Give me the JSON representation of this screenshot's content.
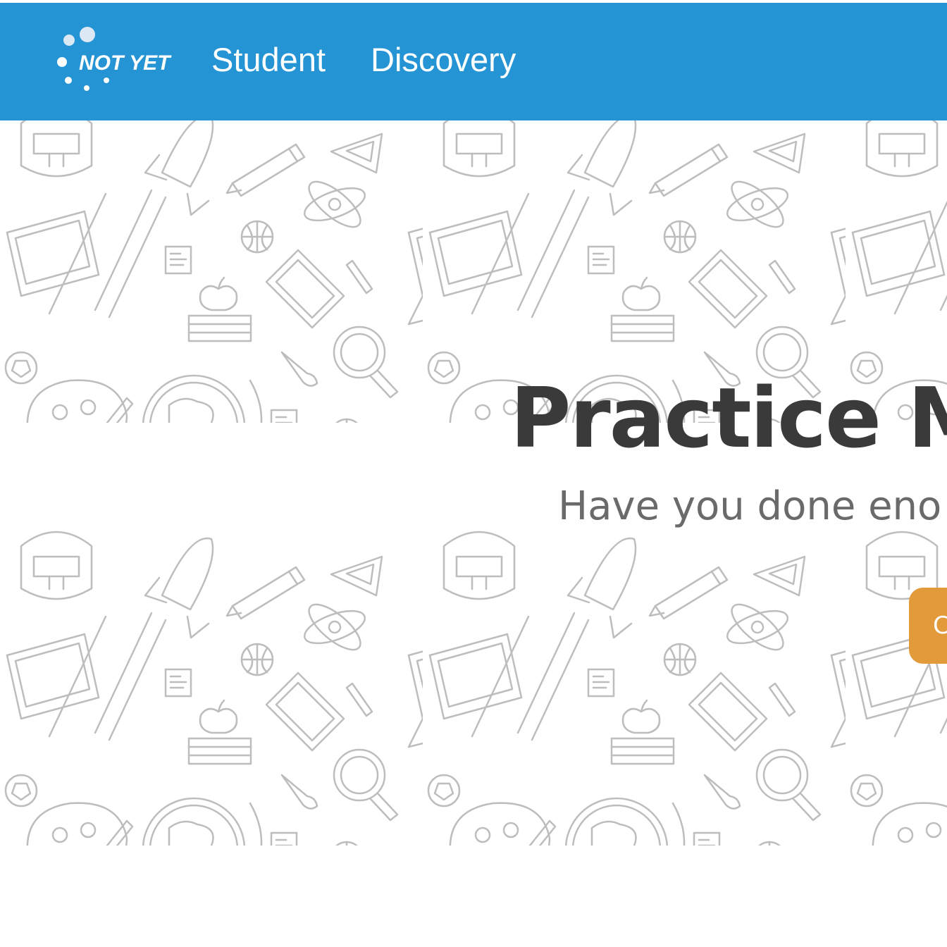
{
  "header": {
    "logo_text": "NOT YET",
    "nav": [
      {
        "label": "Student"
      },
      {
        "label": "Discovery"
      }
    ]
  },
  "hero": {
    "title": "Practice M",
    "subtitle": "Have you done eno",
    "cta_label": "C"
  },
  "colors": {
    "navbar": "#2594d5",
    "title": "#3a3a3a",
    "subtitle": "#6a6a6a",
    "cta": "#e39a3b",
    "pattern_stroke": "#b9b9b9"
  },
  "background_pattern_icons": [
    "backpack-icon",
    "rocket-icon",
    "pencil-icon",
    "triangle-ruler-icon",
    "atom-icon",
    "laptop-icon",
    "basketball-icon",
    "grade-paper-icon",
    "book-icon",
    "apple-icon",
    "books-stack-icon",
    "magnifier-icon",
    "soccer-ball-icon",
    "paint-palette-icon",
    "paintbrush-icon",
    "globe-icon",
    "flask-icon",
    "calculator-icon"
  ]
}
